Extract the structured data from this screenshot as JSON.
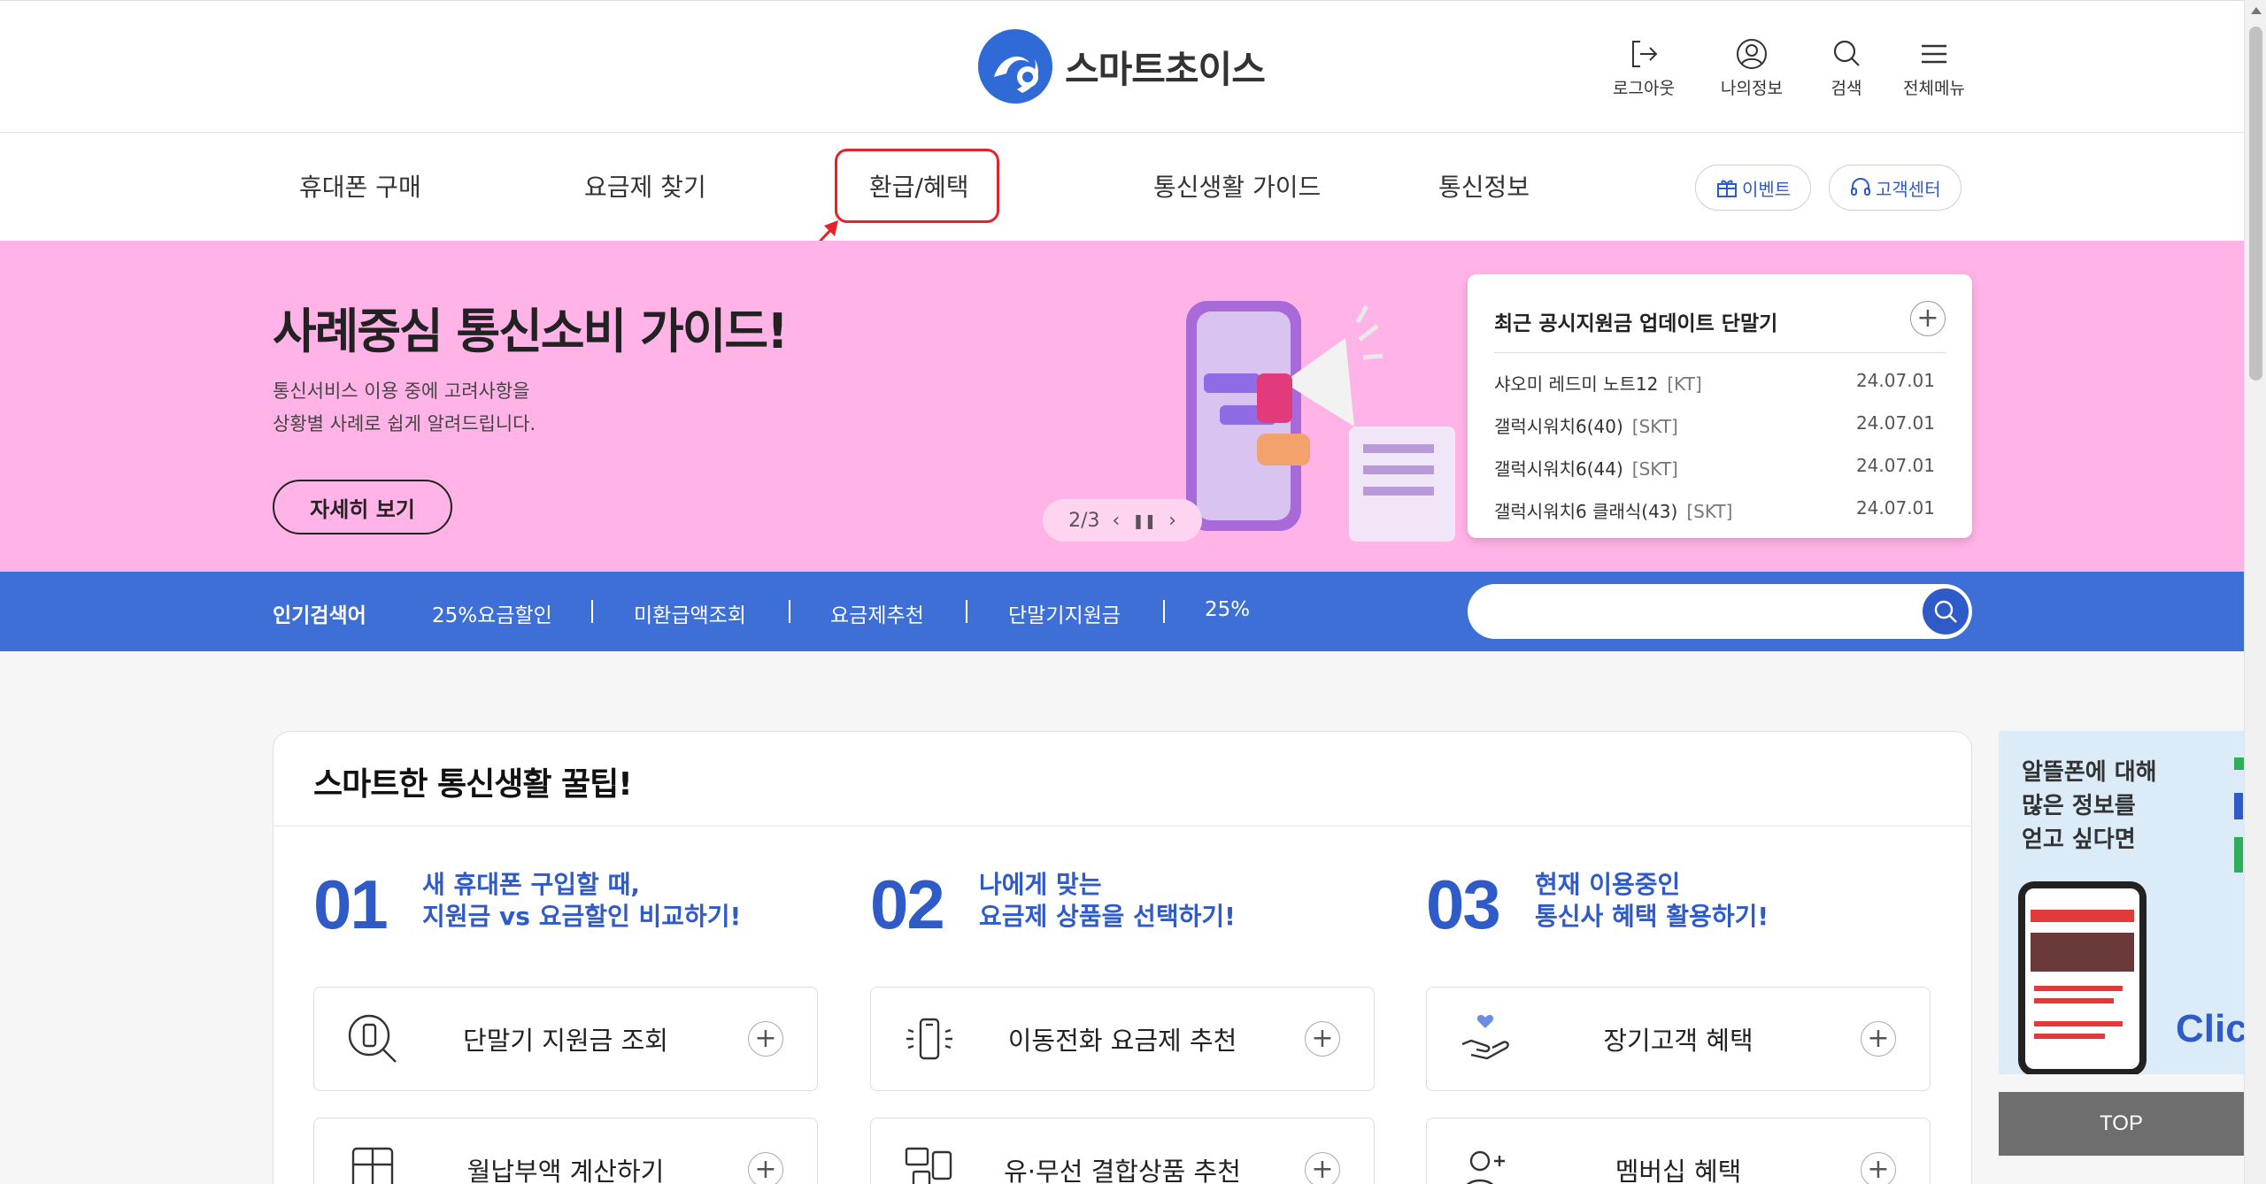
{
  "header": {
    "logo_text": "스마트초이스",
    "utils": [
      {
        "label": "로그아웃",
        "icon": "logout-icon"
      },
      {
        "label": "나의정보",
        "icon": "user-icon"
      },
      {
        "label": "검색",
        "icon": "search-icon"
      },
      {
        "label": "전체메뉴",
        "icon": "menu-icon"
      }
    ]
  },
  "gnb": {
    "items": [
      "휴대폰 구매",
      "요금제 찾기",
      "환급/혜택",
      "통신생활 가이드",
      "통신정보"
    ],
    "event_label": "이벤트",
    "support_label": "고객센터"
  },
  "banner": {
    "title": "사례중심 통신소비 가이드!",
    "desc_line1": "통신서비스 이용 중에 고려사항을",
    "desc_line2": "상황별 사례로 쉽게 알려드립니다.",
    "button": "자세히 보기",
    "pager": "2/3"
  },
  "notice": {
    "title": "최근 공시지원금 업데이트 단말기",
    "rows": [
      {
        "name": "샤오미 레드미 노트12",
        "carrier": "[KT]",
        "date": "24.07.01"
      },
      {
        "name": "갤럭시워치6(40)",
        "carrier": "[SKT]",
        "date": "24.07.01"
      },
      {
        "name": "갤럭시워치6(44)",
        "carrier": "[SKT]",
        "date": "24.07.01"
      },
      {
        "name": "갤럭시워치6 클래식(43)",
        "carrier": "[SKT]",
        "date": "24.07.01"
      }
    ]
  },
  "popular": {
    "label": "인기검색어",
    "keywords": [
      "25%요금할인",
      "미환급액조회",
      "요금제추천",
      "단말기지원금",
      "25%"
    ]
  },
  "search": {
    "placeholder": ""
  },
  "tips": {
    "title": "스마트한 통신생활 꿀팁!",
    "steps": [
      {
        "num": "01",
        "line1": "새 휴대폰 구입할 때,",
        "line2": "지원금 vs 요금할인 비교하기!"
      },
      {
        "num": "02",
        "line1": "나에게 맞는",
        "line2": "요금제 상품을 선택하기!"
      },
      {
        "num": "03",
        "line1": "현재 이용중인",
        "line2": "통신사 혜택 활용하기!"
      }
    ],
    "services": [
      "단말기 지원금 조회",
      "이동전화 요금제 추천",
      "장기고객 혜택",
      "월납부액 계산하기",
      "유·무선 결합상품 추천",
      "멤버십 혜택"
    ]
  },
  "side": {
    "ad_line1": "알뜰폰에 대해",
    "ad_line2": "많은 정보를",
    "ad_line3": "얻고 싶다면",
    "ad_click": "Click",
    "top": "TOP"
  },
  "colors": {
    "accent": "#2f5bc9",
    "banner_bg": "#ffb3e6",
    "searchbar_bg": "#3d6fd7",
    "highlight": "#e3222a"
  }
}
